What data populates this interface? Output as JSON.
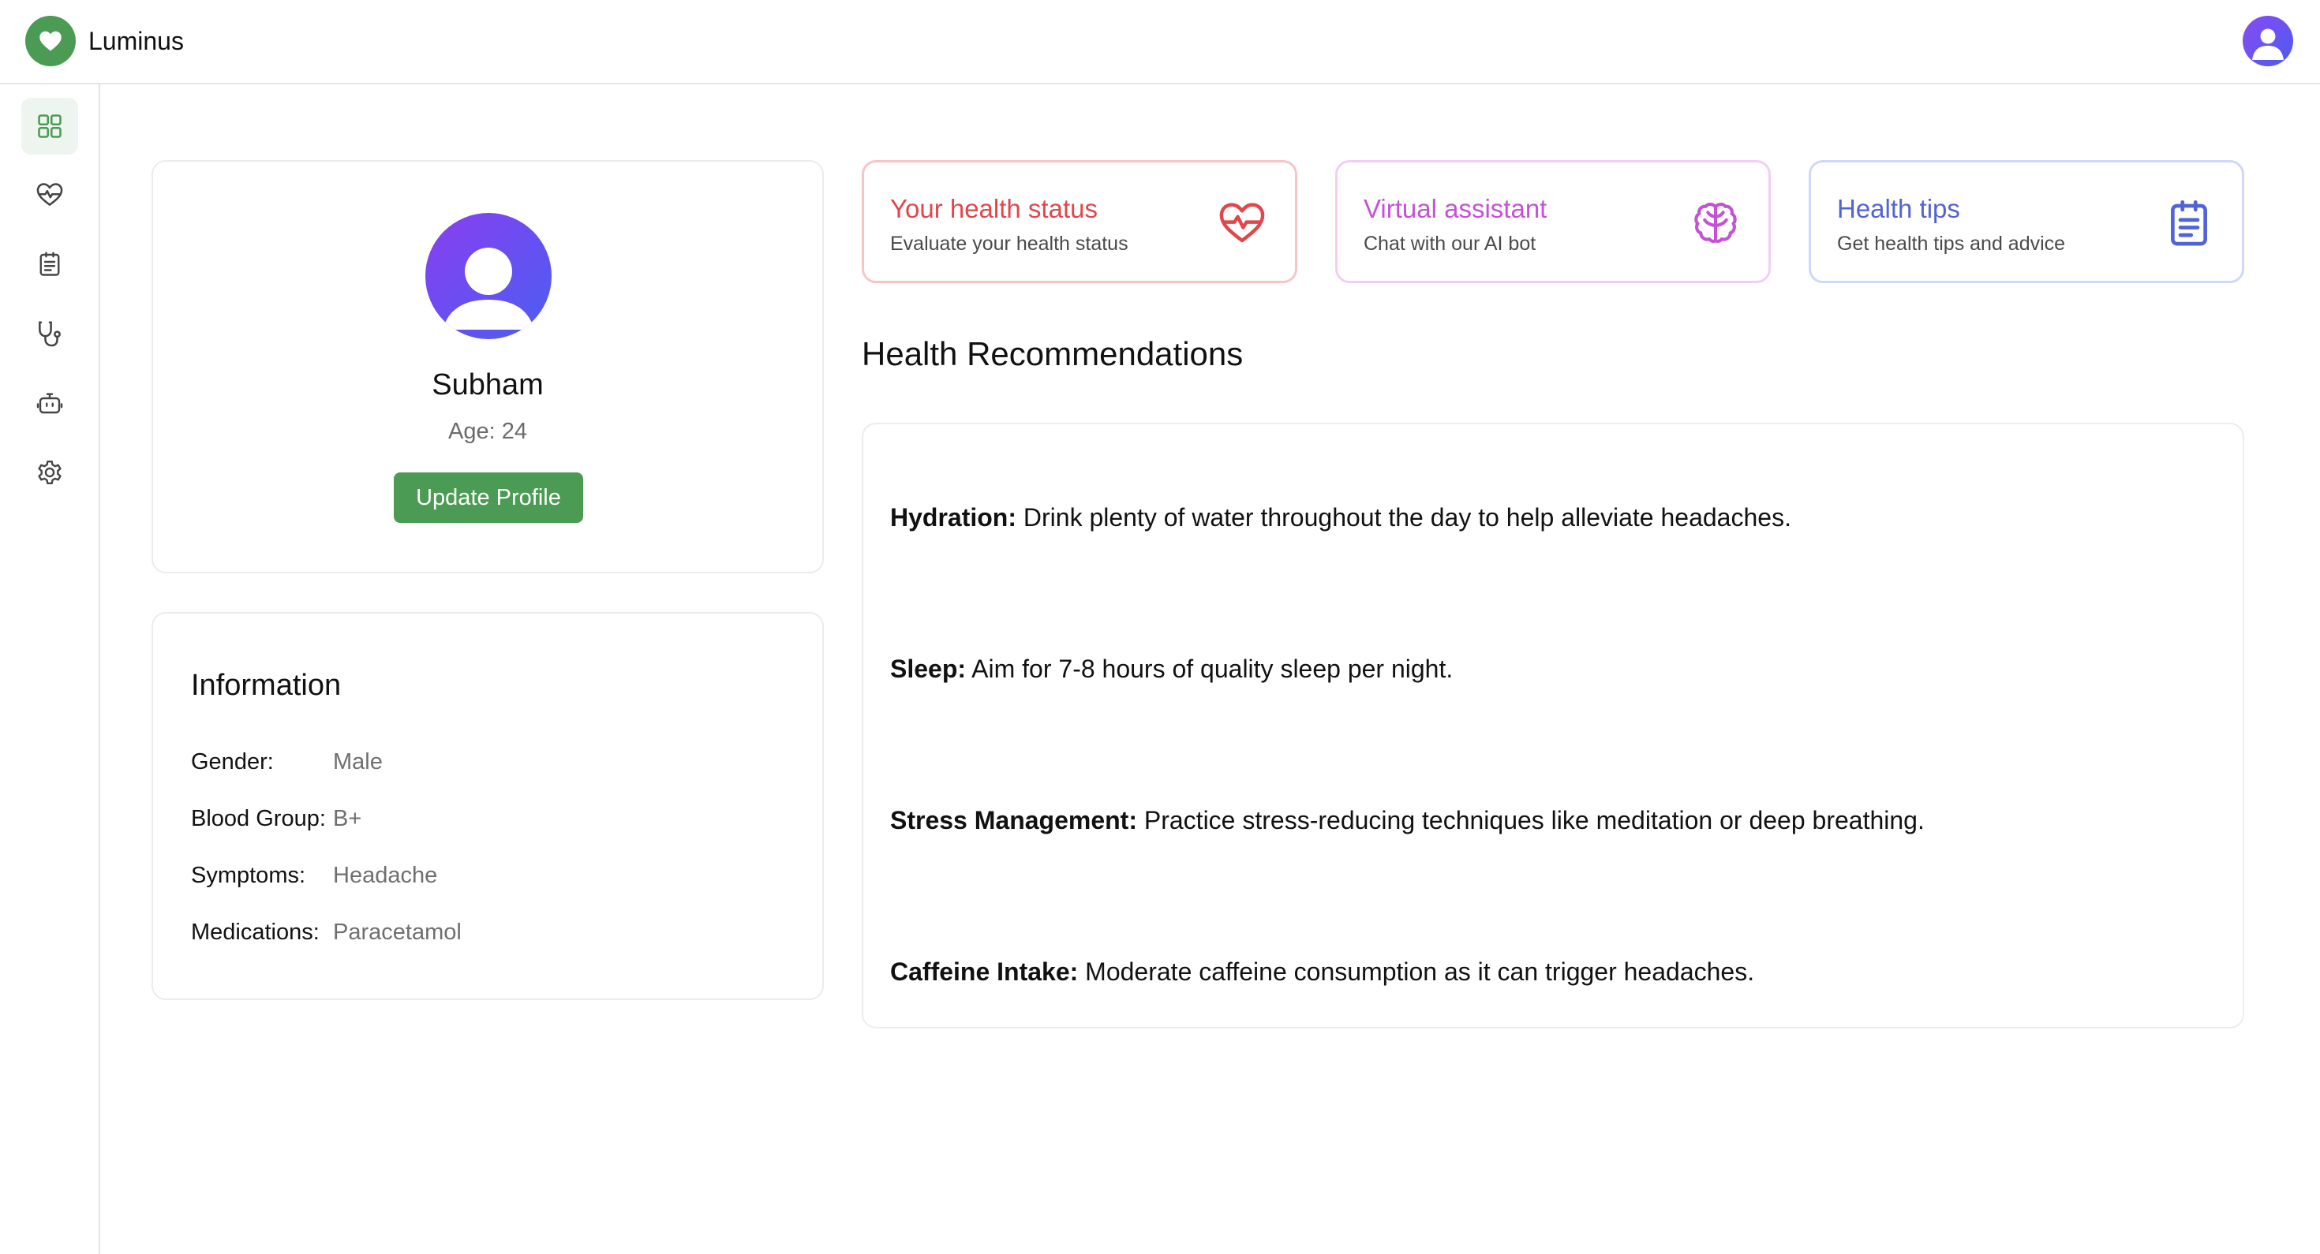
{
  "app": {
    "name": "Luminus",
    "brand_color": "#4c9b54"
  },
  "header": {
    "logo_icon": "heart-icon",
    "avatar_icon": "user-avatar-icon"
  },
  "sidebar": {
    "items": [
      {
        "icon": "dashboard-grid-icon",
        "active": true
      },
      {
        "icon": "heart-pulse-icon",
        "active": false
      },
      {
        "icon": "clipboard-icon",
        "active": false
      },
      {
        "icon": "stethoscope-icon",
        "active": false
      },
      {
        "icon": "bot-icon",
        "active": false
      },
      {
        "icon": "settings-gear-icon",
        "active": false
      }
    ]
  },
  "profile": {
    "name": "Subham",
    "age_text": "Age: 24",
    "update_button": "Update Profile"
  },
  "information": {
    "title": "Information",
    "rows": [
      {
        "label": "Gender:",
        "value": "Male"
      },
      {
        "label": "Blood Group:",
        "value": "B+"
      },
      {
        "label": "Symptoms:",
        "value": "Headache"
      },
      {
        "label": "Medications:",
        "value": "Paracetamol"
      }
    ]
  },
  "quick_cards": [
    {
      "title": "Your health status",
      "subtitle": "Evaluate your health status",
      "icon": "heart-pulse-icon",
      "color": "#e0474a"
    },
    {
      "title": "Virtual assistant",
      "subtitle": "Chat with our AI bot",
      "icon": "brain-icon",
      "color": "#c552d6"
    },
    {
      "title": "Health tips",
      "subtitle": "Get health tips and advice",
      "icon": "clipboard-list-icon",
      "color": "#5163d8"
    }
  ],
  "recommendations": {
    "heading": "Health Recommendations",
    "items": [
      {
        "label": "Hydration:",
        "text": " Drink plenty of water throughout the day to help alleviate headaches."
      },
      {
        "label": "Sleep:",
        "text": " Aim for 7-8 hours of quality sleep per night."
      },
      {
        "label": "Stress Management:",
        "text": " Practice stress-reducing techniques like meditation or deep breathing."
      },
      {
        "label": "Caffeine Intake:",
        "text": " Moderate caffeine consumption as it can trigger headaches."
      }
    ]
  }
}
